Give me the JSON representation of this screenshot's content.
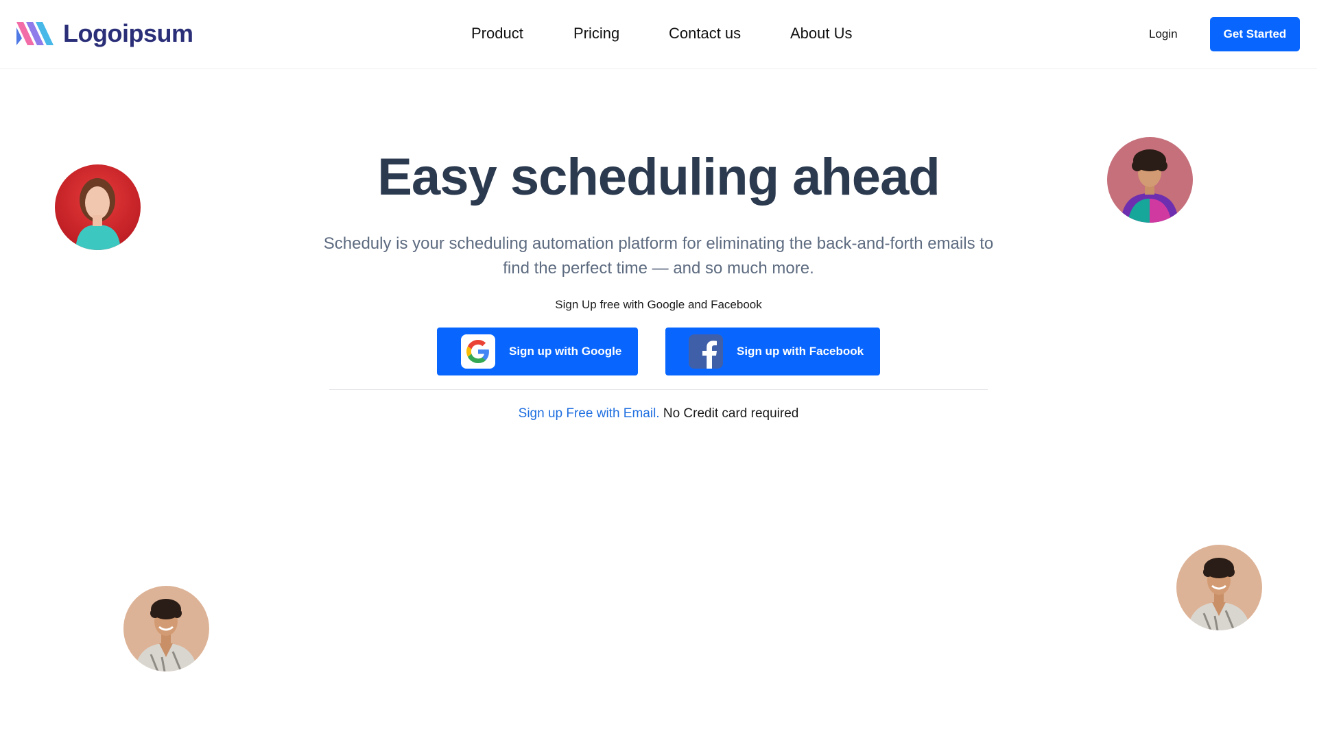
{
  "header": {
    "logo_text": "Logoipsum",
    "nav": [
      {
        "label": "Product"
      },
      {
        "label": "Pricing"
      },
      {
        "label": "Contact us"
      },
      {
        "label": "About Us"
      }
    ],
    "login_label": "Login",
    "cta_label": "Get Started"
  },
  "hero": {
    "title": "Easy scheduling ahead",
    "subtitle": "Scheduly is your scheduling automation platform for eliminating the back-and-forth emails to find the perfect time — and so much more.",
    "signup_caption": "Sign Up free with Google and Facebook",
    "google_button": "Sign up with Google",
    "facebook_button": "Sign up with Facebook",
    "email_link": "Sign up Free with Email.",
    "email_note": " No Credit card required"
  },
  "icons": {
    "logo": "logo-mark-icon",
    "google": "google-icon",
    "facebook": "facebook-icon"
  },
  "colors": {
    "primary": "#0866ff",
    "title": "#2c3a4f",
    "subtitle": "#5d6b80",
    "logo_text": "#2b2f78",
    "link": "#1f6fe0"
  }
}
